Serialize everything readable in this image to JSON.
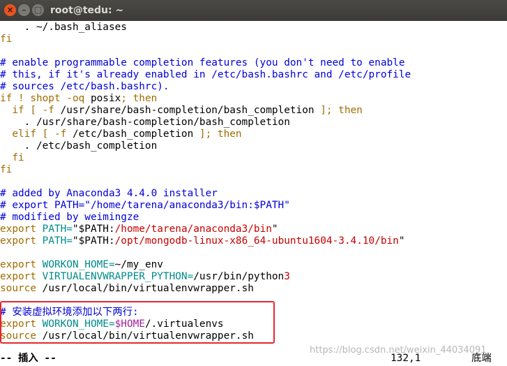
{
  "window": {
    "title": "root@tedu: ~",
    "buttons": {
      "close": "×",
      "minimize": "–",
      "maximize": "□"
    }
  },
  "editor": {
    "lines": [
      {
        "segments": [
          {
            "t": "    . ~/.bash_aliases",
            "c": "normal"
          }
        ]
      },
      {
        "segments": [
          {
            "t": "fi",
            "c": "keyword"
          }
        ]
      },
      {
        "segments": []
      },
      {
        "segments": [
          {
            "t": "# enable programmable completion features (you don't need to enable",
            "c": "comment"
          }
        ]
      },
      {
        "segments": [
          {
            "t": "# this, if it's already enabled in /etc/bash.bashrc and /etc/profile",
            "c": "comment"
          }
        ]
      },
      {
        "segments": [
          {
            "t": "# sources /etc/bash.bashrc).",
            "c": "comment"
          }
        ]
      },
      {
        "segments": [
          {
            "t": "if ! shopt -oq ",
            "c": "keyword"
          },
          {
            "t": "posix",
            "c": "normal"
          },
          {
            "t": "; then",
            "c": "keyword"
          }
        ]
      },
      {
        "segments": [
          {
            "t": "  if [ -f ",
            "c": "keyword"
          },
          {
            "t": "/usr/share/bash-completion/bash_completion",
            "c": "normal"
          },
          {
            "t": " ]; then",
            "c": "keyword"
          }
        ]
      },
      {
        "segments": [
          {
            "t": "    . /usr/share/bash-completion/bash_completion",
            "c": "normal"
          }
        ]
      },
      {
        "segments": [
          {
            "t": "  elif [ -f ",
            "c": "keyword"
          },
          {
            "t": "/etc/bash_completion",
            "c": "normal"
          },
          {
            "t": " ]; then",
            "c": "keyword"
          }
        ]
      },
      {
        "segments": [
          {
            "t": "    . /etc/bash_completion",
            "c": "normal"
          }
        ]
      },
      {
        "segments": [
          {
            "t": "  fi",
            "c": "keyword"
          }
        ]
      },
      {
        "segments": [
          {
            "t": "fi",
            "c": "keyword"
          }
        ]
      },
      {
        "segments": []
      },
      {
        "segments": [
          {
            "t": "# added by Anaconda3 4.4.0 installer",
            "c": "comment"
          }
        ]
      },
      {
        "segments": [
          {
            "t": "# export PATH=\"/home/tarena/anaconda3/bin:$PATH\"",
            "c": "comment"
          }
        ]
      },
      {
        "segments": [
          {
            "t": "# modified by weimingze",
            "c": "comment"
          }
        ]
      },
      {
        "segments": [
          {
            "t": "export ",
            "c": "keyword"
          },
          {
            "t": "PATH=",
            "c": "var"
          },
          {
            "t": "\"$PATH:",
            "c": "normal"
          },
          {
            "t": "/home/tarena/anaconda3/bin",
            "c": "string"
          },
          {
            "t": "\"",
            "c": "normal"
          }
        ]
      },
      {
        "segments": [
          {
            "t": "export ",
            "c": "keyword"
          },
          {
            "t": "PATH=",
            "c": "var"
          },
          {
            "t": "\"$PATH:",
            "c": "normal"
          },
          {
            "t": "/opt/mongodb-linux-x86_64-ubuntu1604-3.4.10/bin",
            "c": "string"
          },
          {
            "t": "\"",
            "c": "normal"
          }
        ]
      },
      {
        "segments": []
      },
      {
        "segments": [
          {
            "t": "export ",
            "c": "keyword"
          },
          {
            "t": "WORKON_HOME=",
            "c": "var"
          },
          {
            "t": "~/my_env",
            "c": "normal"
          }
        ]
      },
      {
        "segments": [
          {
            "t": "export ",
            "c": "keyword"
          },
          {
            "t": "VIRTUALENVWRAPPER_PYTHON=",
            "c": "var"
          },
          {
            "t": "/usr/bin/python",
            "c": "normal"
          },
          {
            "t": "3",
            "c": "string"
          }
        ]
      },
      {
        "segments": [
          {
            "t": "source ",
            "c": "keyword"
          },
          {
            "t": "/usr/local/bin/virtualenvwrapper.sh",
            "c": "normal"
          }
        ]
      },
      {
        "segments": []
      },
      {
        "segments": [
          {
            "t": "# 安装虚拟环境添加以下两行:",
            "c": "comment"
          }
        ]
      },
      {
        "segments": [
          {
            "t": "export ",
            "c": "keyword"
          },
          {
            "t": "WORKON_HOME=",
            "c": "var"
          },
          {
            "t": "$HOME",
            "c": "magenta"
          },
          {
            "t": "/.virtualenvs",
            "c": "normal"
          }
        ]
      },
      {
        "segments": [
          {
            "t": "source ",
            "c": "keyword"
          },
          {
            "t": "/usr/local/bin/virtualenvwrapper.sh",
            "c": "normal"
          }
        ]
      }
    ]
  },
  "status": {
    "mode": "-- 插入 --",
    "position": "132,1",
    "scroll": "底端"
  },
  "watermark": "https://blog.csdn.net/weixin_44034091",
  "colors": {
    "comment": "#0000d7",
    "keyword": "#a06c00",
    "variable": "#008b8b",
    "string": "#c70000",
    "highlight_box": "#e8262d"
  }
}
